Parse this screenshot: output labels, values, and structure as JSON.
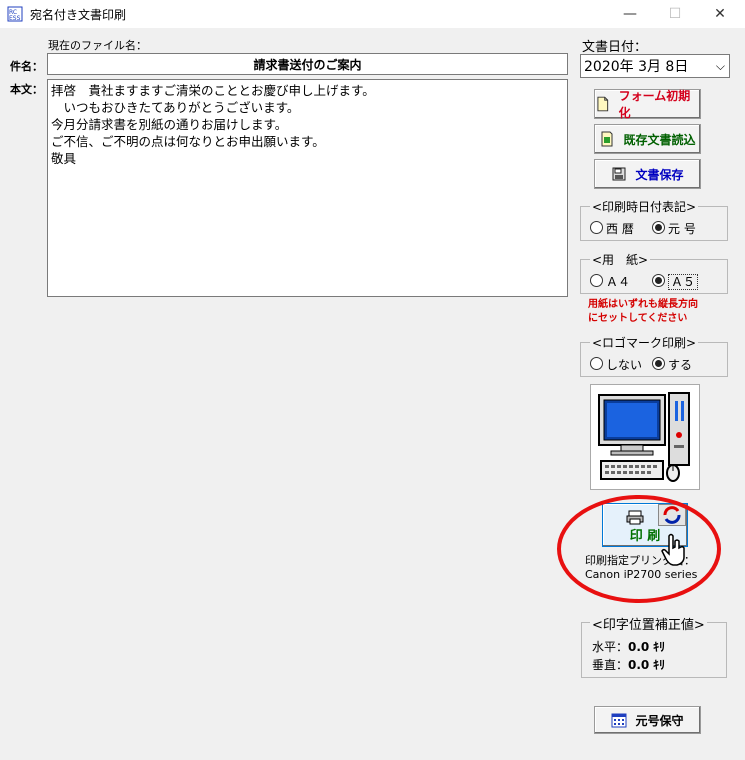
{
  "window": {
    "title": "宛名付き文書印刷",
    "minimize": "—",
    "maximize": "☐",
    "close": "✕"
  },
  "file": {
    "current_label": "現在のファイル名："
  },
  "subject": {
    "label": "件名：",
    "value": "請求書送付のご案内"
  },
  "body": {
    "label": "本文：",
    "lines": [
      "拝啓　貴社ますますご清栄のこととお慶び申し上げます。",
      "　いつもおひきたてありがとうございます。",
      "今月分請求書を別紙の通りお届けします。",
      "ご不信、ご不明の点は何なりとお申出願います。",
      "敬具"
    ]
  },
  "date": {
    "label": "文書日付：",
    "value": "2020年 3月 8日"
  },
  "buttons": {
    "form_init": "フォーム初期化",
    "load_doc": "既存文書読込",
    "save_doc": "文書保存",
    "print": "印 刷",
    "era_save": "元号保守"
  },
  "date_format": {
    "title": "<印刷時日付表記>",
    "options": [
      "西 暦",
      "元 号"
    ],
    "selected": 1
  },
  "paper": {
    "title": "<用　紙>",
    "options": [
      "Ａ４",
      "Ａ５"
    ],
    "selected": 1,
    "note_line1": "用紙はいずれも縦長方向",
    "note_line2": "にセットしてください",
    "note_color": "#d40000"
  },
  "logo": {
    "title": "<ロゴマーク印刷>",
    "options": [
      "しない",
      "する"
    ],
    "selected": 1
  },
  "printer": {
    "label": "印刷指定プリンタ名：",
    "name": "Canon iP2700 series"
  },
  "offset": {
    "title": "<印字位置補正値>",
    "horizontal_label": "水平：",
    "horizontal_value": "0.0",
    "vertical_label": "垂直：",
    "vertical_value": "0.0",
    "unit": "ｷﾘ"
  },
  "colors": {
    "red_circle": "#e81010",
    "accent_blue": "#1f3fbf",
    "button_text_red": "#d4001c",
    "button_text_green": "#006000",
    "button_text_blue": "#0000c0"
  }
}
